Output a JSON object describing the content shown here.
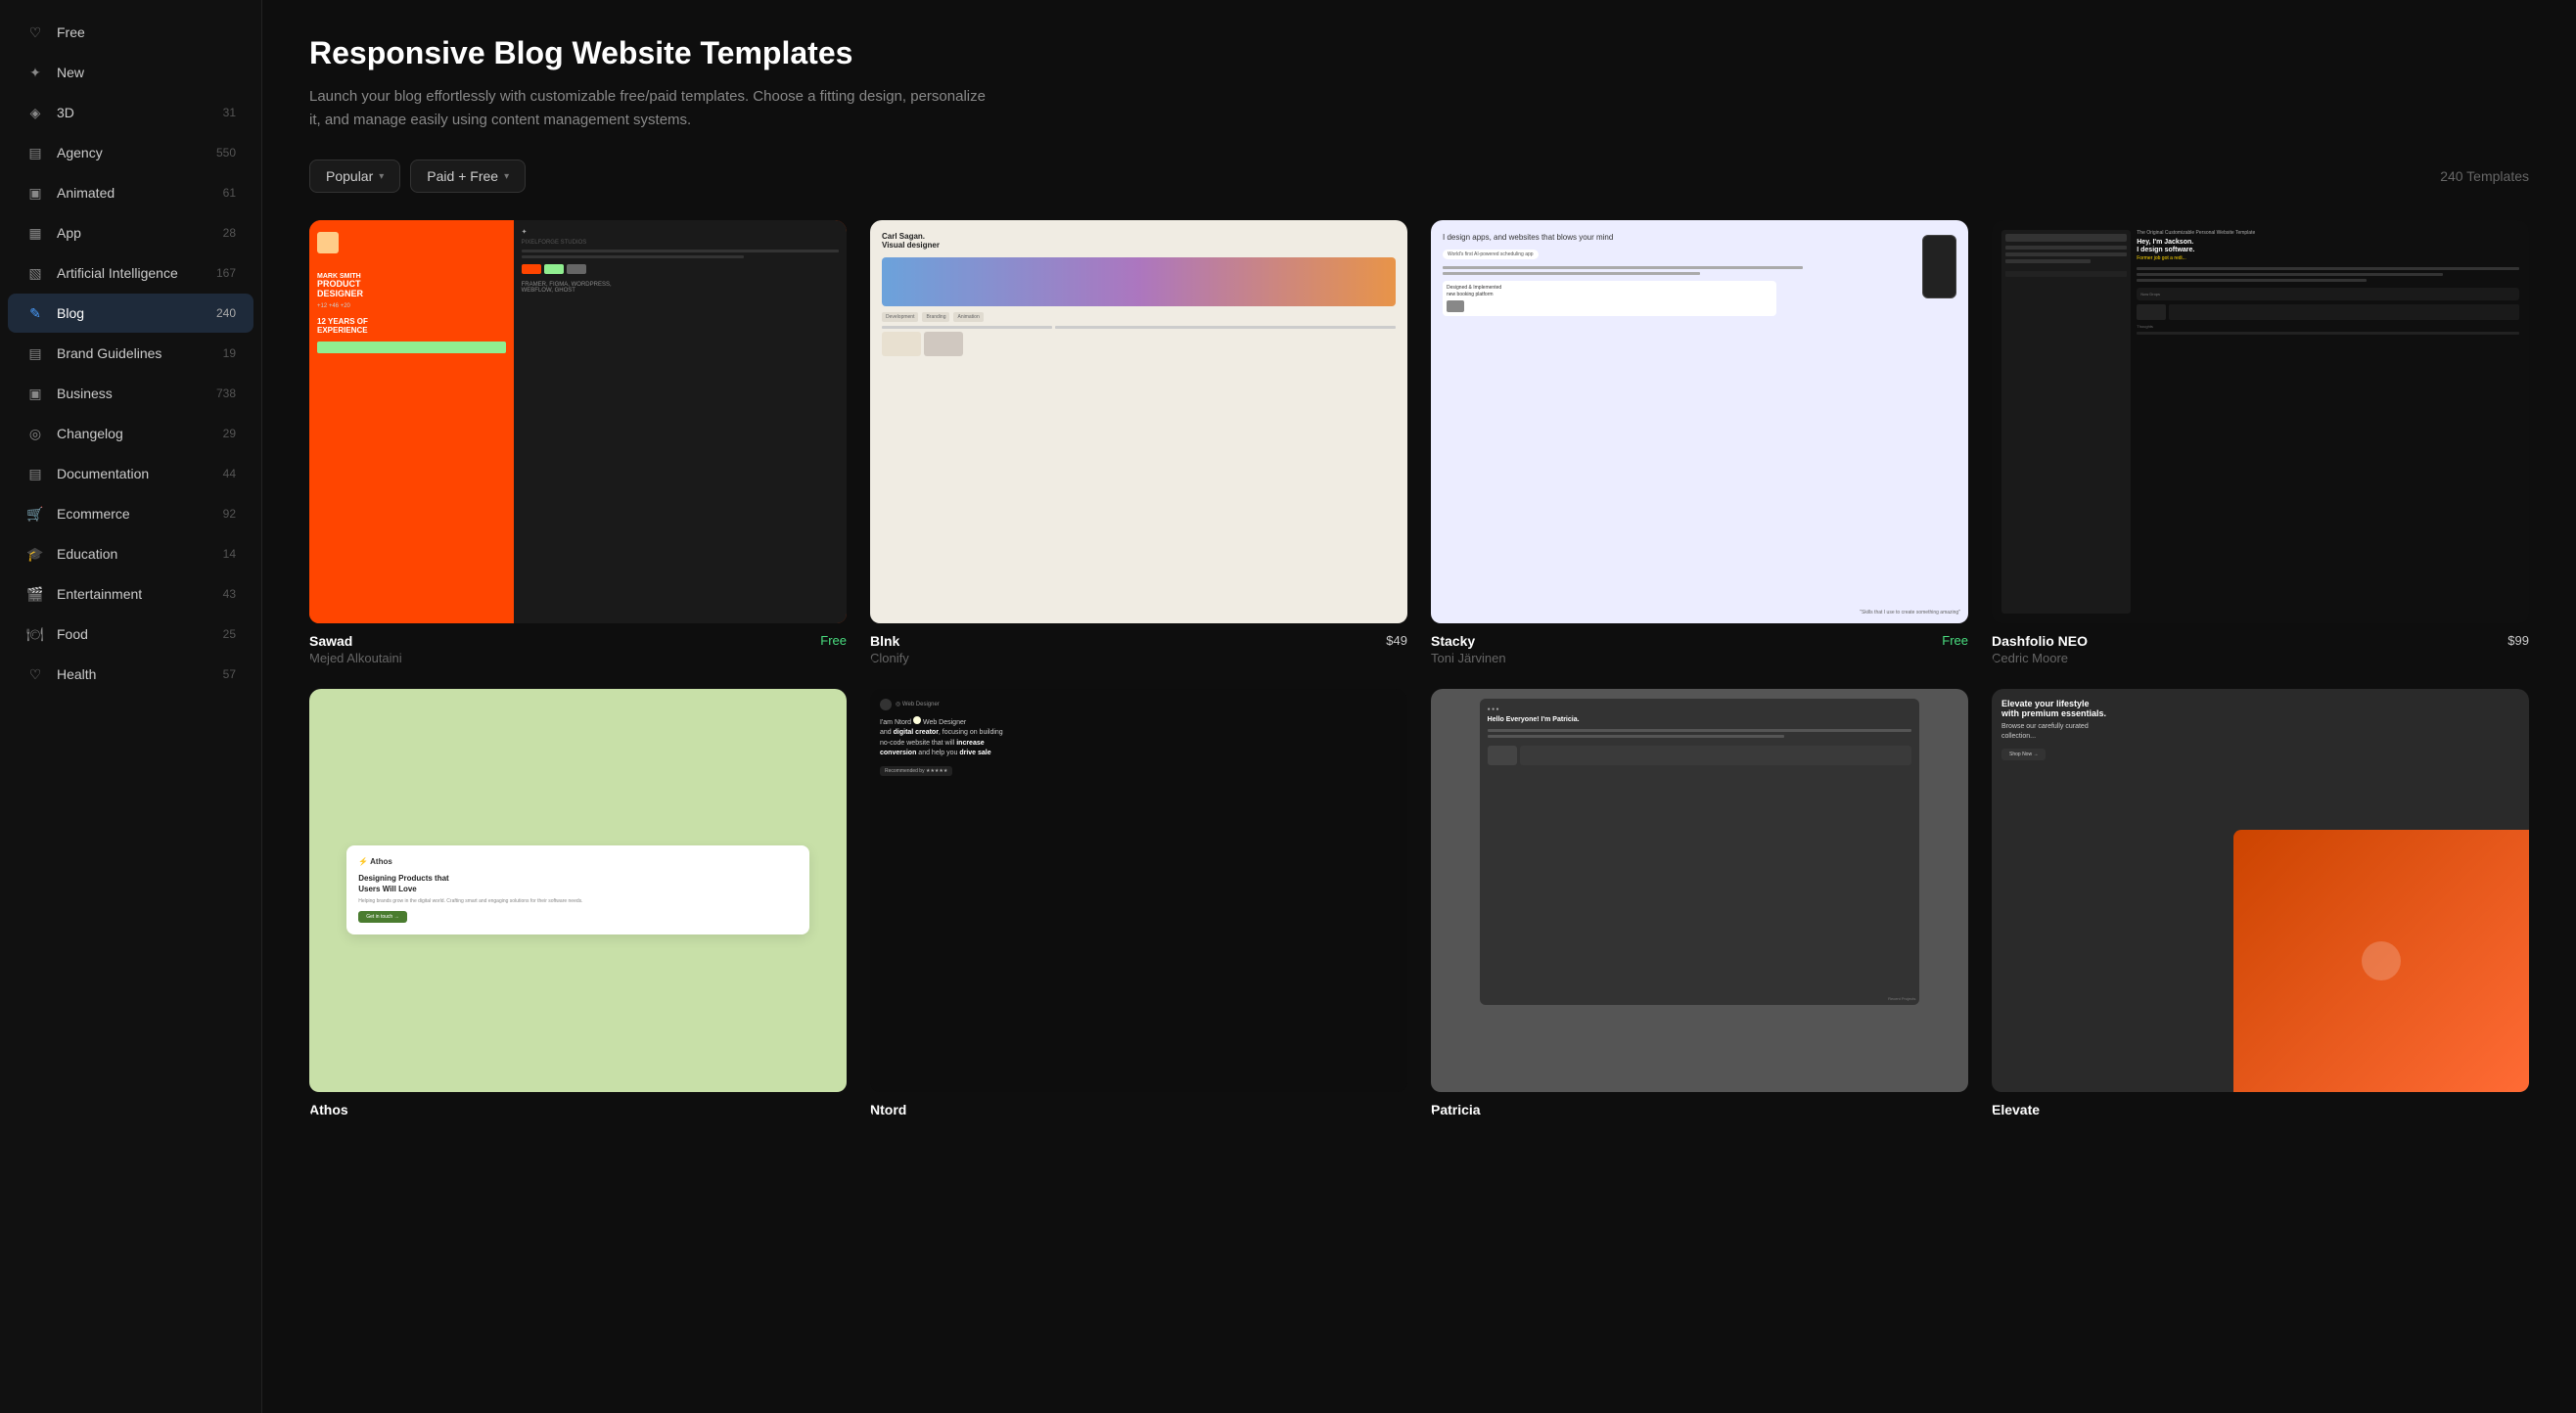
{
  "sidebar": {
    "items": [
      {
        "id": "free",
        "label": "Free",
        "count": null,
        "icon": "♡",
        "active": false
      },
      {
        "id": "new",
        "label": "New",
        "count": null,
        "icon": "✦",
        "active": false
      },
      {
        "id": "3d",
        "label": "3D",
        "count": "31",
        "icon": "◈",
        "active": false
      },
      {
        "id": "agency",
        "label": "Agency",
        "count": "550",
        "icon": "▤",
        "active": false
      },
      {
        "id": "animated",
        "label": "Animated",
        "count": "61",
        "icon": "▣",
        "active": false
      },
      {
        "id": "app",
        "label": "App",
        "count": "28",
        "icon": "▦",
        "active": false
      },
      {
        "id": "ai",
        "label": "Artificial Intelligence",
        "count": "167",
        "icon": "▧",
        "active": false
      },
      {
        "id": "blog",
        "label": "Blog",
        "count": "240",
        "icon": "✎",
        "active": true
      },
      {
        "id": "brand",
        "label": "Brand Guidelines",
        "count": "19",
        "icon": "▤",
        "active": false
      },
      {
        "id": "business",
        "label": "Business",
        "count": "738",
        "icon": "▣",
        "active": false
      },
      {
        "id": "changelog",
        "label": "Changelog",
        "count": "29",
        "icon": "◎",
        "active": false
      },
      {
        "id": "documentation",
        "label": "Documentation",
        "count": "44",
        "icon": "▤",
        "active": false
      },
      {
        "id": "ecommerce",
        "label": "Ecommerce",
        "count": "92",
        "icon": "🛒",
        "active": false
      },
      {
        "id": "education",
        "label": "Education",
        "count": "14",
        "icon": "🎓",
        "active": false
      },
      {
        "id": "entertainment",
        "label": "Entertainment",
        "count": "43",
        "icon": "🎬",
        "active": false
      },
      {
        "id": "food",
        "label": "Food",
        "count": "25",
        "icon": "🍽",
        "active": false
      },
      {
        "id": "health",
        "label": "Health",
        "count": "57",
        "icon": "♡",
        "active": false
      }
    ]
  },
  "page": {
    "title": "Responsive Blog Website Templates",
    "description": "Launch your blog effortlessly with customizable free/paid templates. Choose a fitting design, personalize it, and manage easily using content management systems.",
    "templates_count": "240 Templates"
  },
  "filters": {
    "sort_label": "Popular",
    "type_label": "Paid + Free"
  },
  "templates": [
    {
      "id": "sawad",
      "name": "Sawad",
      "author": "Mejed Alkoutaini",
      "price": "Free",
      "price_type": "free",
      "thumb_type": "sawad"
    },
    {
      "id": "blnk",
      "name": "Blnk",
      "author": "Clonify",
      "price": "$49",
      "price_type": "paid",
      "thumb_type": "blnk"
    },
    {
      "id": "stacky",
      "name": "Stacky",
      "author": "Toni Järvinen",
      "price": "Free",
      "price_type": "free",
      "thumb_type": "stacky"
    },
    {
      "id": "dashfolio",
      "name": "Dashfolio NEO",
      "author": "Cedric Moore",
      "price": "$99",
      "price_type": "paid",
      "thumb_type": "dashfolio"
    },
    {
      "id": "athos",
      "name": "Athos",
      "author": "",
      "price": "",
      "price_type": "",
      "thumb_type": "athos"
    },
    {
      "id": "ntord",
      "name": "Ntord",
      "author": "",
      "price": "",
      "price_type": "",
      "thumb_type": "ntord"
    },
    {
      "id": "patricia",
      "name": "Patricia",
      "author": "",
      "price": "",
      "price_type": "",
      "thumb_type": "patricia"
    },
    {
      "id": "elevate",
      "name": "Elevate",
      "author": "",
      "price": "",
      "price_type": "",
      "thumb_type": "elevate"
    }
  ]
}
